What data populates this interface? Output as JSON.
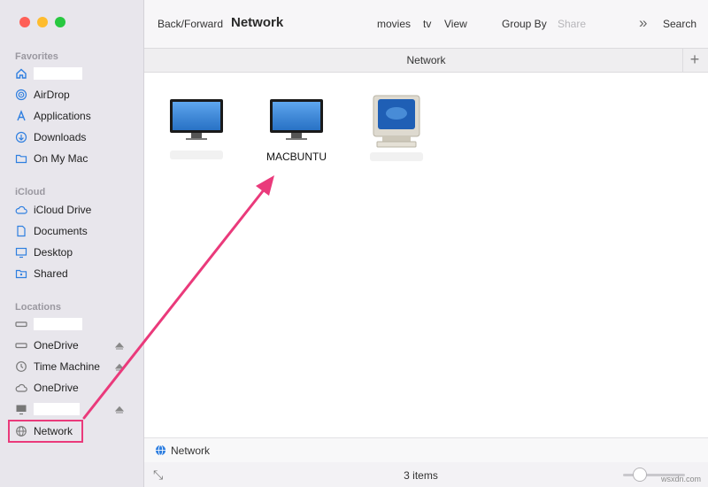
{
  "sidebar": {
    "favorites_title": "Favorites",
    "icloud_title": "iCloud",
    "locations_title": "Locations",
    "favorites": [
      {
        "label": "",
        "icon": "home-icon"
      },
      {
        "label": "AirDrop",
        "icon": "airdrop-icon"
      },
      {
        "label": "Applications",
        "icon": "applications-icon"
      },
      {
        "label": "Downloads",
        "icon": "downloads-icon"
      },
      {
        "label": "On My Mac",
        "icon": "folder-icon"
      }
    ],
    "icloud": [
      {
        "label": "iCloud Drive",
        "icon": "cloud-icon"
      },
      {
        "label": "Documents",
        "icon": "document-icon"
      },
      {
        "label": "Desktop",
        "icon": "desktop-icon"
      },
      {
        "label": "Shared",
        "icon": "shared-folder-icon"
      }
    ],
    "locations": [
      {
        "label": "",
        "icon": "drive-icon"
      },
      {
        "label": "OneDrive",
        "icon": "drive-icon"
      },
      {
        "label": "Time Machine",
        "icon": "time-machine-icon"
      },
      {
        "label": "OneDrive",
        "icon": "cloud-icon"
      },
      {
        "label": "",
        "icon": "display-icon"
      },
      {
        "label": "Network",
        "icon": "globe-icon"
      }
    ]
  },
  "toolbar": {
    "back_forward": "Back/Forward",
    "title": "Network",
    "movies": "movies",
    "tv": "tv",
    "view": "View",
    "group_by": "Group By",
    "share": "Share",
    "more": "»",
    "search": "Search"
  },
  "tab": {
    "label": "Network",
    "plus": "+"
  },
  "items": [
    {
      "label": "",
      "icon": "imac-icon"
    },
    {
      "label": "MACBUNTU",
      "icon": "imac-icon"
    },
    {
      "label": "",
      "icon": "crt-monitor-icon"
    }
  ],
  "pathbar": {
    "label": "Network"
  },
  "status": {
    "count": "3 items"
  },
  "zoom": {
    "level": 0.3
  },
  "watermark": "wsxdn.com",
  "colors": {
    "annotation": "#ea3a7b",
    "accent": "#2f7fe0"
  }
}
